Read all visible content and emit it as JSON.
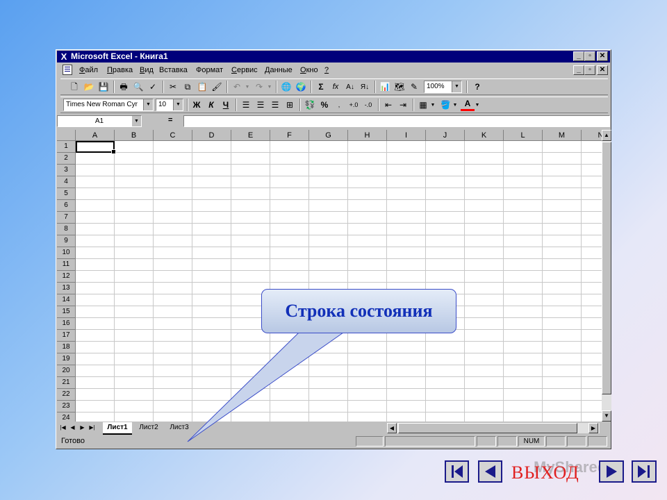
{
  "window": {
    "title": "Microsoft Excel - Книга1",
    "caption_buttons": [
      "_",
      "▫",
      "✕"
    ]
  },
  "menu": {
    "items": [
      {
        "label": "Файл",
        "u": "Ф",
        "rest": "айл"
      },
      {
        "label": "Правка",
        "u": "П",
        "rest": "равка"
      },
      {
        "label": "Вид",
        "u": "В",
        "rest": "ид"
      },
      {
        "label": "Вставка",
        "u": "",
        "rest": "Вставка"
      },
      {
        "label": "Формат",
        "u": "",
        "rest": "Формат"
      },
      {
        "label": "Сервис",
        "u": "С",
        "rest": "ервис"
      },
      {
        "label": "Данные",
        "u": "Д",
        "rest": "анные"
      },
      {
        "label": "Окно",
        "u": "О",
        "rest": "кно"
      },
      {
        "label": "?",
        "u": "?",
        "rest": ""
      }
    ]
  },
  "toolbar": {
    "zoom": "100%",
    "font_name": "Times New Roman Cyr",
    "font_size": "10",
    "bold": "Ж",
    "italic": "К",
    "underline": "Ч",
    "sum": "Σ",
    "fx": "fx",
    "percent": "%"
  },
  "formula_bar": {
    "name_box": "A1",
    "equals": "=",
    "value": ""
  },
  "grid": {
    "columns": [
      "A",
      "B",
      "C",
      "D",
      "E",
      "F",
      "G",
      "H",
      "I",
      "J",
      "K",
      "L",
      "M",
      "N"
    ],
    "rows": [
      "1",
      "2",
      "3",
      "4",
      "5",
      "6",
      "7",
      "8",
      "9",
      "10",
      "11",
      "12",
      "13",
      "14",
      "15",
      "16",
      "17",
      "18",
      "19",
      "20",
      "21",
      "22",
      "23",
      "24"
    ]
  },
  "sheets": [
    "Лист1",
    "Лист2",
    "Лист3"
  ],
  "status": {
    "text": "Готово",
    "num": "NUM"
  },
  "callout": {
    "text": "Строка состояния"
  },
  "slide_nav": {
    "exit_label": "ВЫХОД",
    "watermark": "MyShared"
  },
  "colors": {
    "title_bar": "#00007b",
    "callout_text": "#1230b8",
    "exit_text": "#e02020"
  }
}
